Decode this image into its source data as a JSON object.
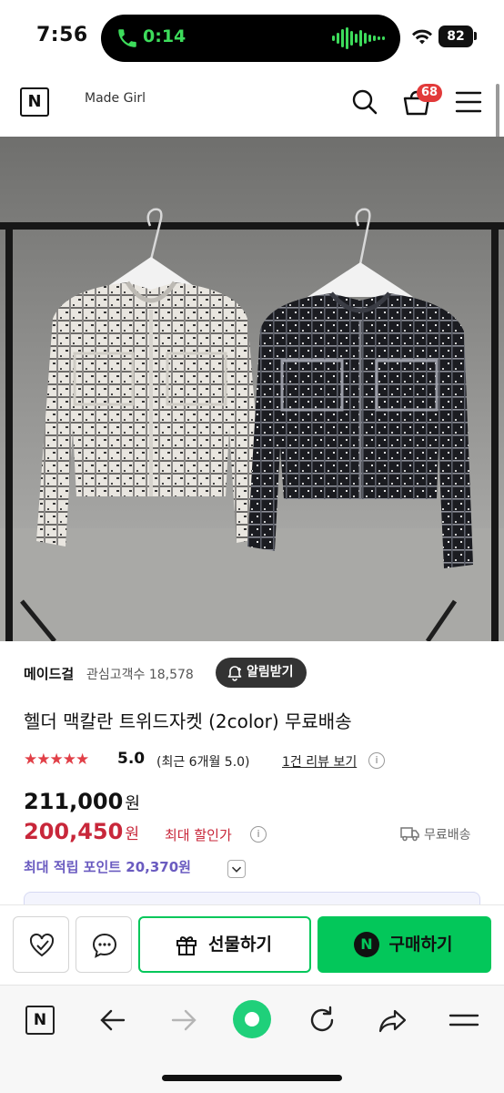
{
  "status_bar": {
    "time": "7:56",
    "call_timer": "0:14",
    "battery": "82"
  },
  "header": {
    "logo_letter": "N",
    "store_name": "Made Girl",
    "cart_count": "68"
  },
  "gallery": {
    "image_description_icon": "product-photo",
    "total_images": 3,
    "active_index": 0
  },
  "store": {
    "name": "메이드걸",
    "interest_label": "관심고객수 18,578",
    "alarm_button": "알림받기"
  },
  "product": {
    "title": "헬더 맥칼란 트위드자켓 (2color) 무료배송",
    "stars": "★★★★★",
    "rating": "5.0",
    "rating_recent": "(최근 6개월 5.0)",
    "review_link": "1건 리뷰 보기",
    "info_glyph": "i",
    "original_price": "211,000",
    "original_price_unit": "원",
    "sale_price": "200,450",
    "sale_price_unit": "원",
    "max_discount_label": "최대 할인가",
    "shipping_label": "무료배송",
    "points_label": "최대 적립 포인트 20,370원"
  },
  "purchase_bar": {
    "gift_button": "선물하기",
    "buy_badge": "N",
    "buy_button": "구매하기"
  },
  "browser": {
    "logo_letter": "N"
  },
  "colors": {
    "naver_green": "#03c75a",
    "sale_red": "#c8273a",
    "star_red": "#e13f47",
    "points_purple": "#6a5bc0",
    "badge_red": "#e23a3a"
  }
}
